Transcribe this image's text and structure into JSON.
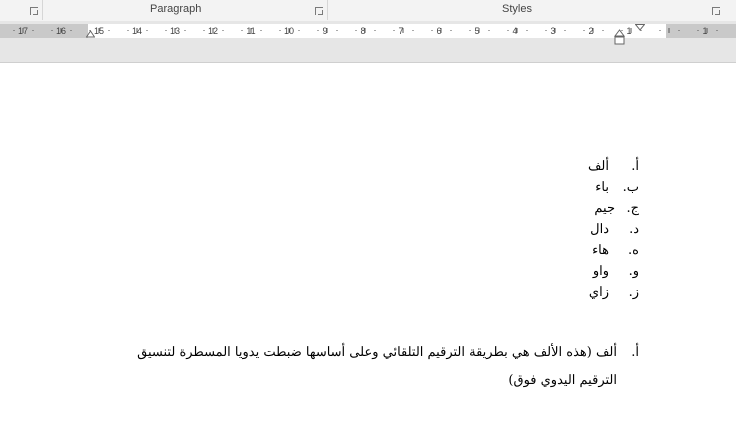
{
  "ribbon": {
    "group_labels": {
      "paragraph": "Paragraph",
      "styles": "Styles"
    }
  },
  "ruler": {
    "numbers": [
      "17",
      "16",
      "15",
      "14",
      "13",
      "12",
      "11",
      "10",
      "9",
      "8",
      "7",
      "6",
      "5",
      "4",
      "3",
      "2",
      "1",
      "1"
    ]
  },
  "document": {
    "list": [
      {
        "number": "أ.",
        "text": "ألف"
      },
      {
        "number": "ب.",
        "text": "باء"
      },
      {
        "number": "ج.",
        "text": "جيم"
      },
      {
        "number": "د.",
        "text": "دال"
      },
      {
        "number": "ه.",
        "text": "هاء"
      },
      {
        "number": "و.",
        "text": "واو"
      },
      {
        "number": "ز.",
        "text": "زاي"
      }
    ],
    "paragraph": {
      "number": "أ.",
      "text": "ألف (هذه الألف هي بطريقة الترقيم التلقائي وعلى أساسها ضبطت يدويا المسطرة لتنسيق الترقيم اليدوي فوق)"
    }
  }
}
